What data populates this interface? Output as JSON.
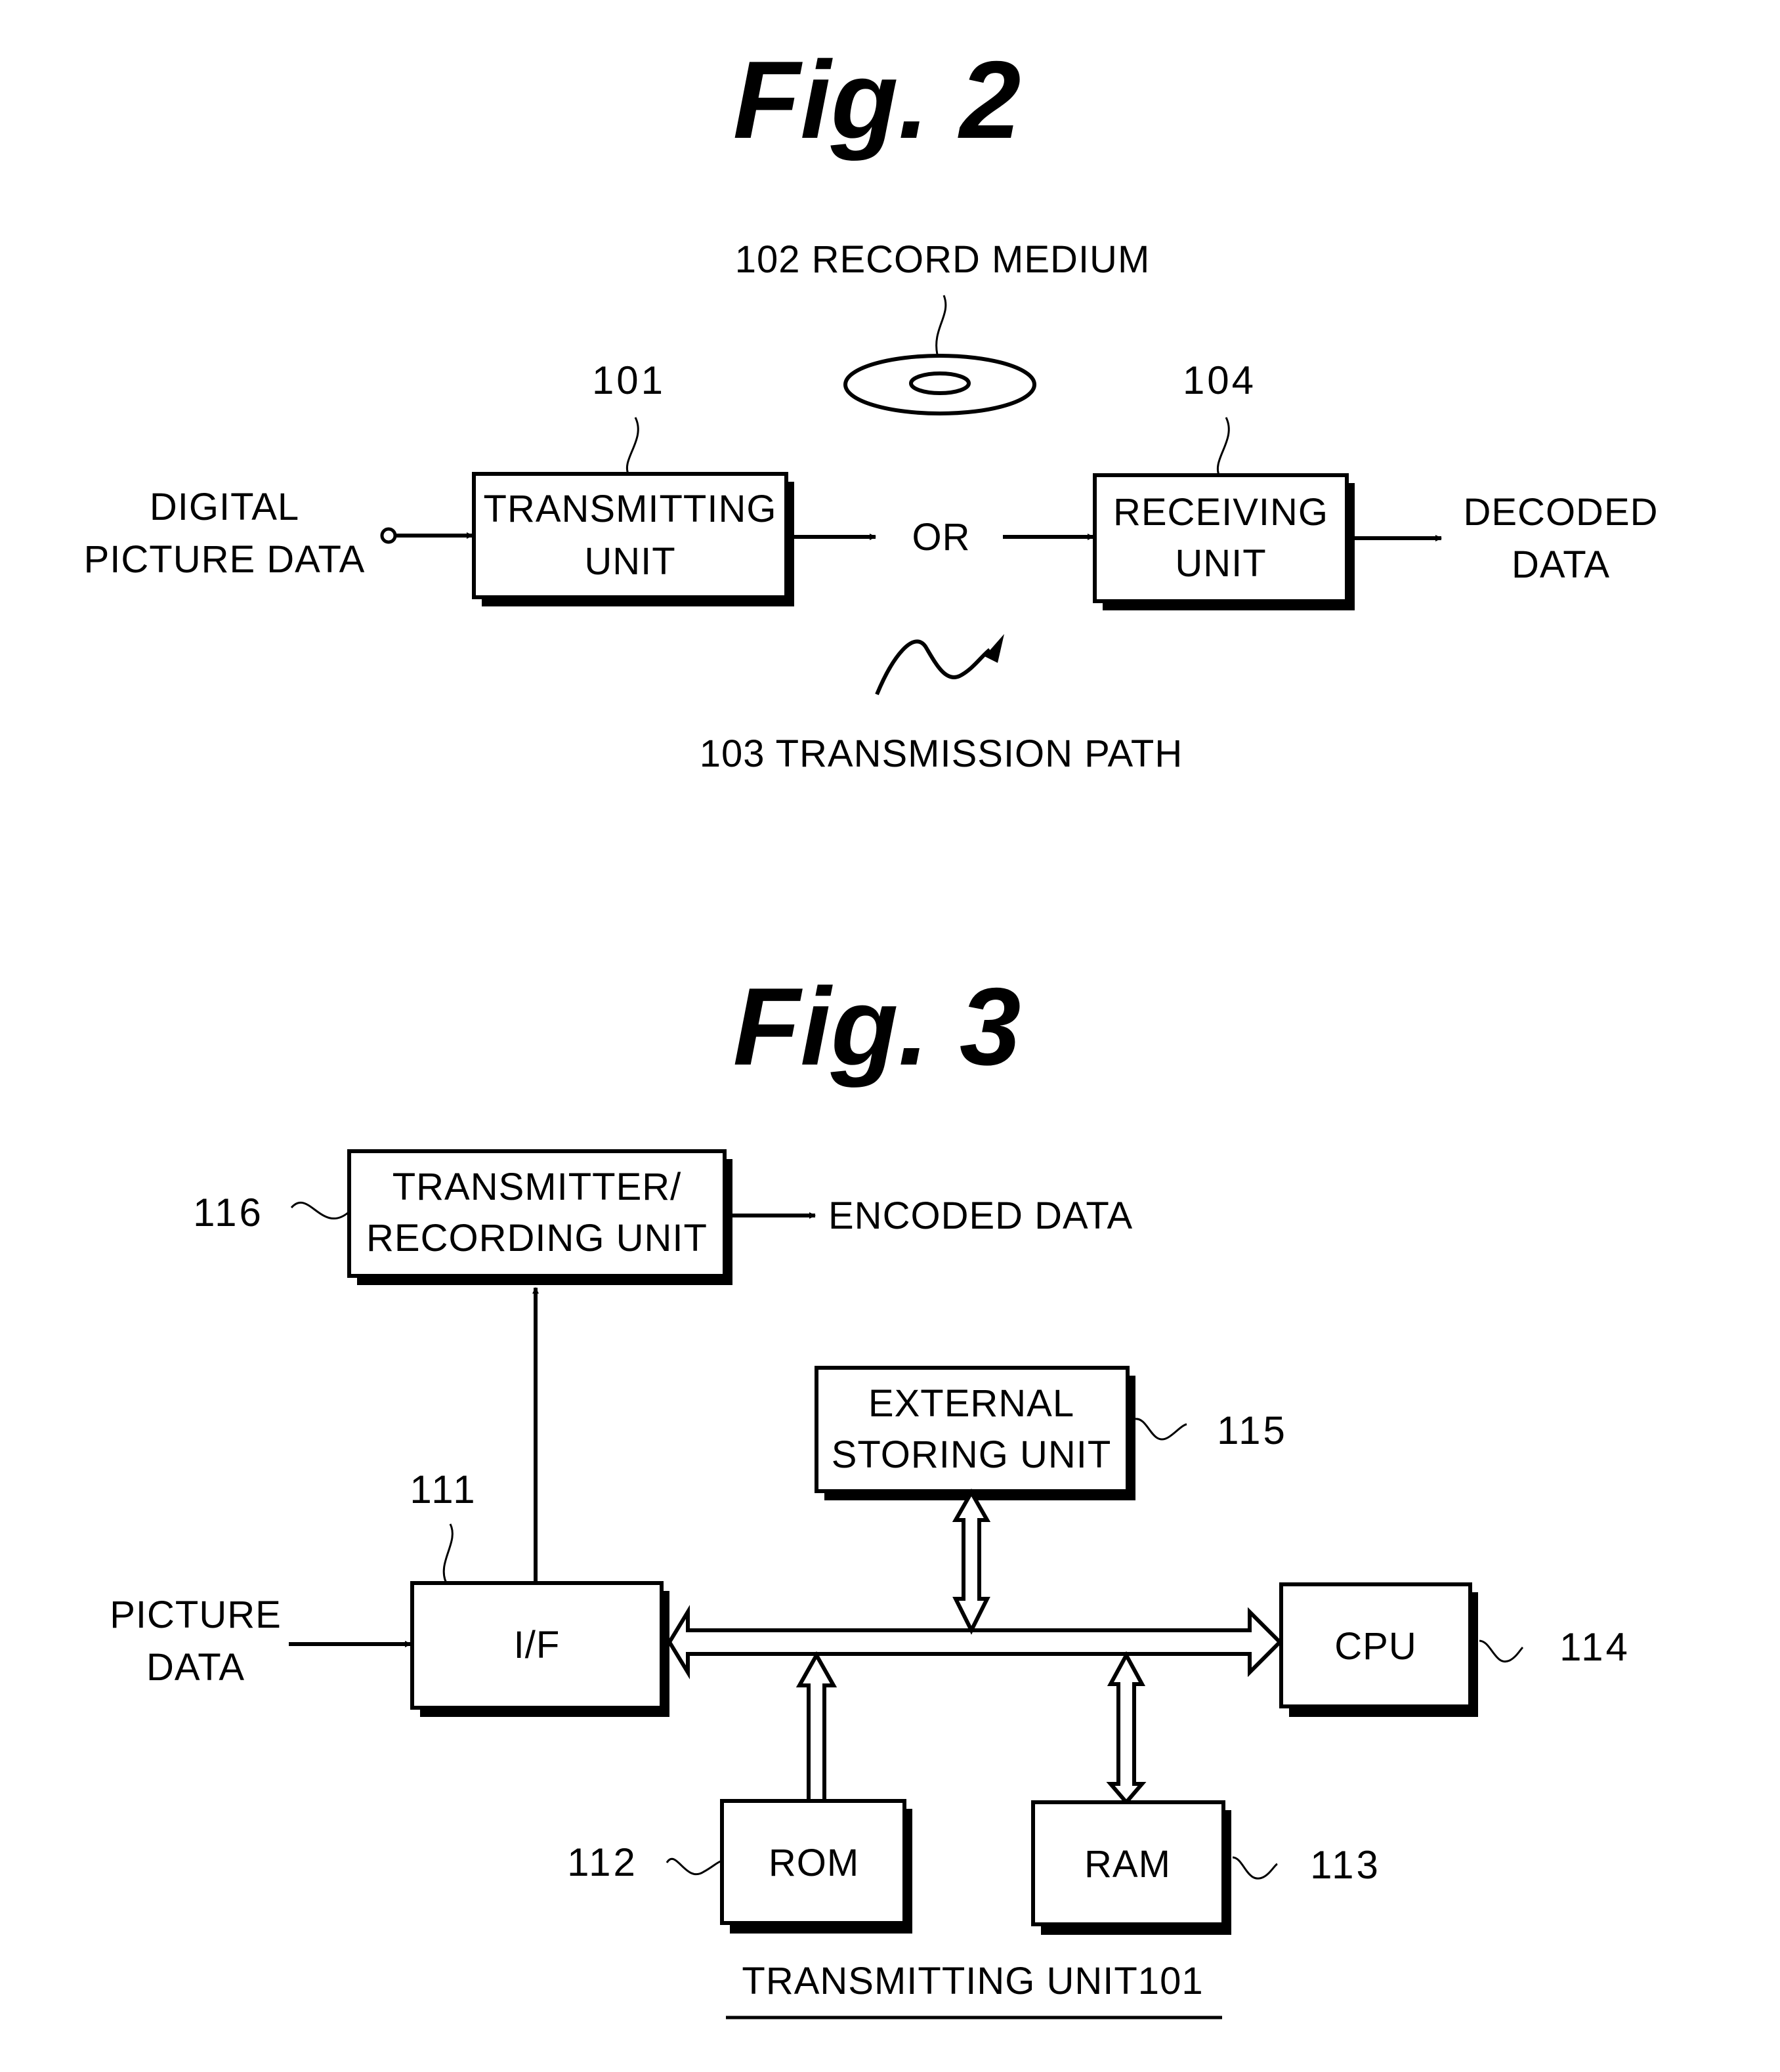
{
  "fig2": {
    "title": "Fig.  2",
    "record_medium_label": "102 RECORD MEDIUM",
    "transmission_path_label": "103 TRANSMISSION PATH",
    "input_label_line1": "DIGITAL",
    "input_label_line2": "PICTURE DATA",
    "transmitting_unit": {
      "ref": "101",
      "line1": "TRANSMITTING",
      "line2": "UNIT"
    },
    "or_label": "OR",
    "receiving_unit": {
      "ref": "104",
      "line1": "RECEIVING",
      "line2": "UNIT"
    },
    "output_label_line1": "DECODED",
    "output_label_line2": "DATA"
  },
  "fig3": {
    "title": "Fig.  3",
    "transmitter_recording_unit": {
      "ref": "116",
      "line1": "TRANSMITTER/",
      "line2": "RECORDING UNIT"
    },
    "encoded_data_label": "ENCODED DATA",
    "external_storing_unit": {
      "ref": "115",
      "line1": "EXTERNAL",
      "line2": "STORING UNIT"
    },
    "interface": {
      "ref": "111",
      "label": "I/F"
    },
    "input_label_line1": "PICTURE",
    "input_label_line2": "DATA",
    "cpu": {
      "ref": "114",
      "label": "CPU"
    },
    "rom": {
      "ref": "112",
      "label": "ROM"
    },
    "ram": {
      "ref": "113",
      "label": "RAM"
    },
    "caption": "TRANSMITTING UNIT101"
  }
}
